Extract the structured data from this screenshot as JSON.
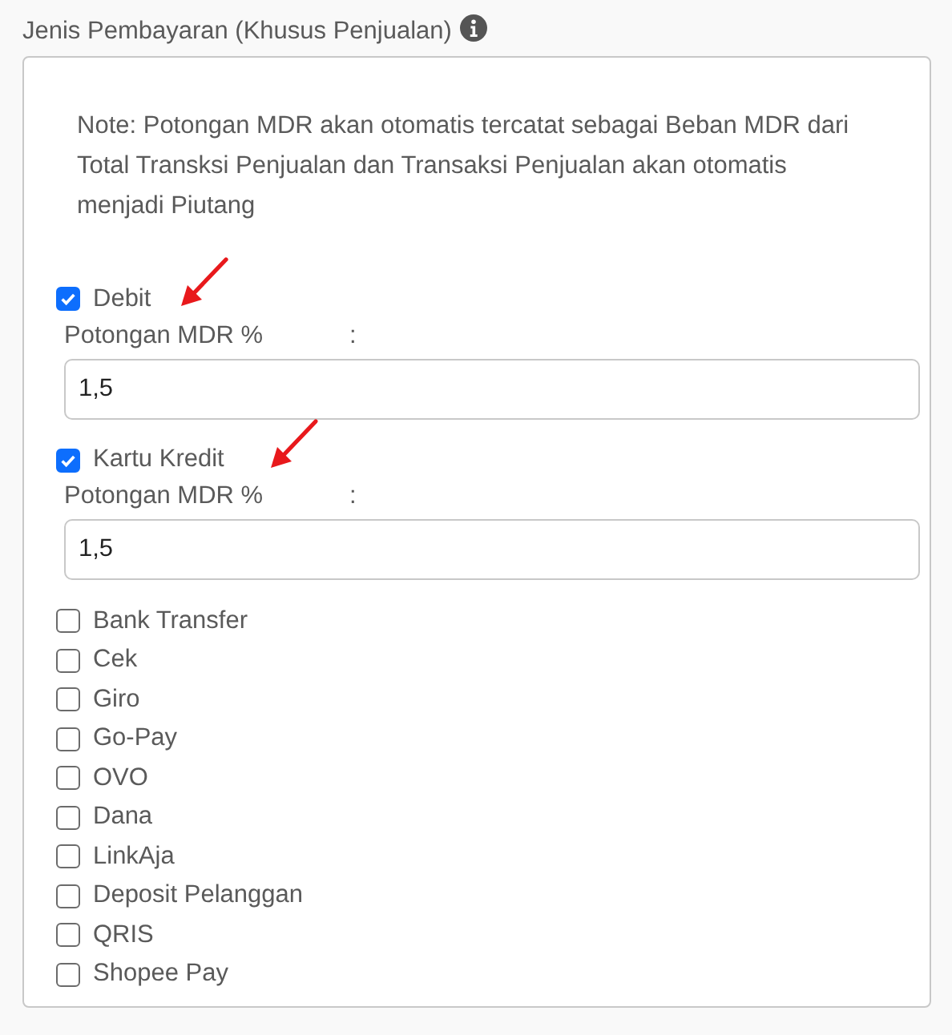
{
  "title": "Jenis Pembayaran (Khusus Penjualan)",
  "note": "Note: Potongan MDR akan otomatis tercatat sebagai Beban MDR dari Total Transksi Penjualan dan Transaksi Penjualan akan otomatis menjadi Piutang",
  "methods": [
    {
      "label": "Debit",
      "checked": true,
      "annotated": true,
      "mdr": {
        "label": "Potongan MDR %",
        "separator": ":",
        "value": "1,5"
      }
    },
    {
      "label": "Kartu Kredit",
      "checked": true,
      "annotated": true,
      "mdr": {
        "label": "Potongan MDR %",
        "separator": ":",
        "value": "1,5"
      }
    },
    {
      "label": "Bank Transfer",
      "checked": false,
      "annotated": false
    },
    {
      "label": "Cek",
      "checked": false,
      "annotated": false
    },
    {
      "label": "Giro",
      "checked": false,
      "annotated": false
    },
    {
      "label": "Go-Pay",
      "checked": false,
      "annotated": false
    },
    {
      "label": "OVO",
      "checked": false,
      "annotated": false
    },
    {
      "label": "Dana",
      "checked": false,
      "annotated": false
    },
    {
      "label": "LinkAja",
      "checked": false,
      "annotated": false
    },
    {
      "label": "Deposit Pelanggan",
      "checked": false,
      "annotated": false
    },
    {
      "label": "QRIS",
      "checked": false,
      "annotated": false
    },
    {
      "label": "Shopee Pay",
      "checked": false,
      "annotated": false
    }
  ]
}
